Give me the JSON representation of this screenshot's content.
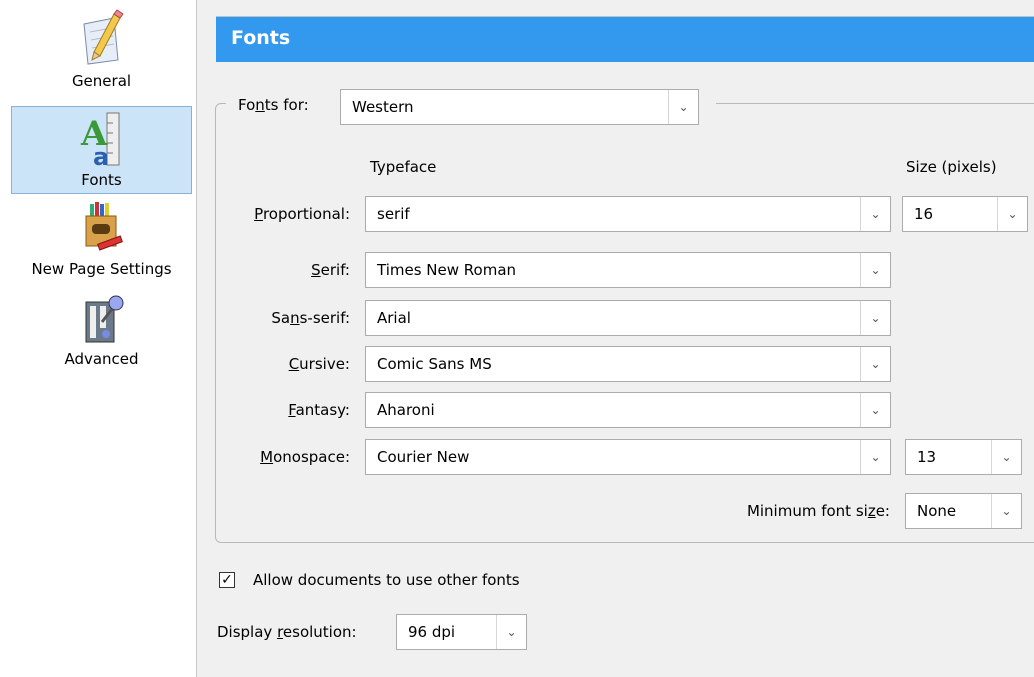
{
  "sidebar": {
    "items": [
      {
        "label": "General",
        "icon": "pencil-paper-icon"
      },
      {
        "label": "Fonts",
        "icon": "fonts-icon"
      },
      {
        "label": "New Page Settings",
        "icon": "crayon-box-icon"
      },
      {
        "label": "Advanced",
        "icon": "switch-icon"
      }
    ],
    "selected": "Fonts"
  },
  "header": {
    "title": "Fonts"
  },
  "fonts_for": {
    "label_pre": "Fo",
    "label_u": "n",
    "label_post": "ts for:",
    "value": "Western"
  },
  "columns": {
    "typeface": "Typeface",
    "size": "Size (pixels)"
  },
  "rows": {
    "proportional": {
      "label_u": "P",
      "label_rest": "roportional:",
      "value": "serif",
      "size": "16"
    },
    "serif": {
      "label_u": "S",
      "label_rest": "erif:",
      "value": "Times New Roman"
    },
    "sans_serif": {
      "label_pre": "Sa",
      "label_u": "n",
      "label_rest": "s-serif:",
      "value": "Arial"
    },
    "cursive": {
      "label_u": "C",
      "label_rest": "ursive:",
      "value": "Comic Sans MS"
    },
    "fantasy": {
      "label_u": "F",
      "label_rest": "antasy:",
      "value": "Aharoni"
    },
    "monospace": {
      "label_u": "M",
      "label_rest": "onospace:",
      "value": "Courier New",
      "size": "13"
    }
  },
  "min_font": {
    "label_pre": "Minimum font si",
    "label_u": "z",
    "label_post": "e:",
    "value": "None"
  },
  "allow_fonts": {
    "label": "Allow documents to use other fonts",
    "checked": true
  },
  "resolution": {
    "label_pre": "Display ",
    "label_u": "r",
    "label_post": "esolution:",
    "value": "96 dpi"
  }
}
